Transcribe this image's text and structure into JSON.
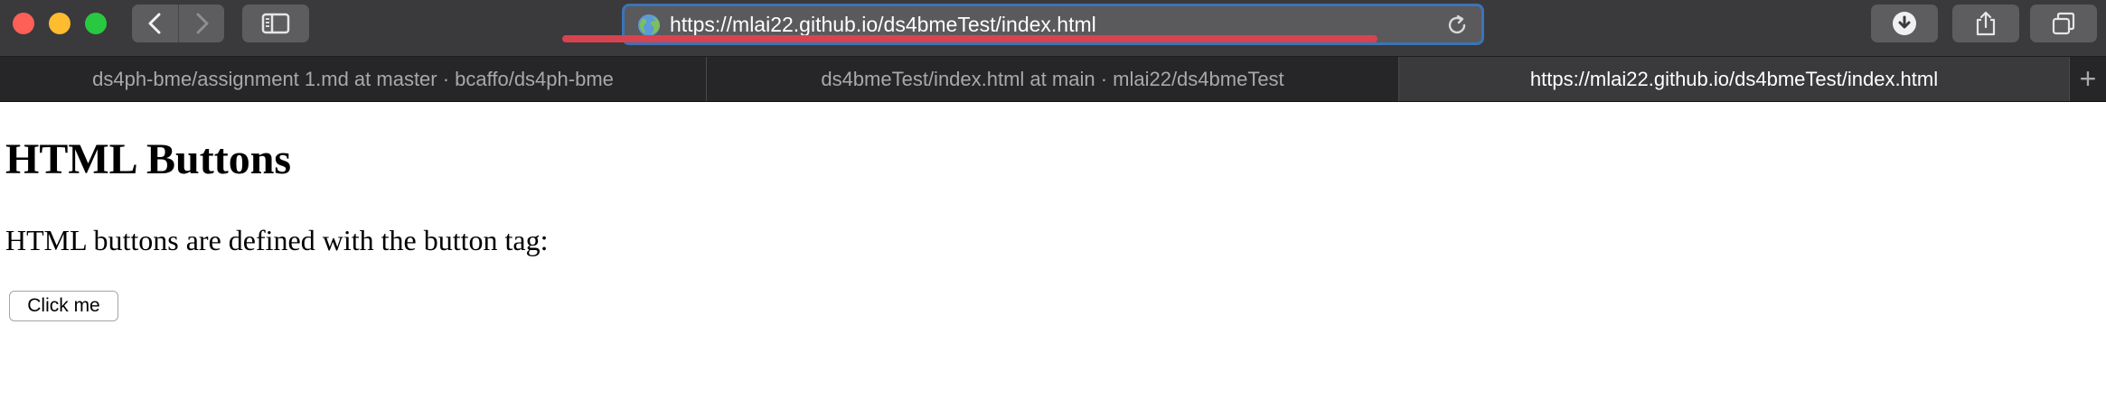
{
  "browser": {
    "address_bar": {
      "url": "https://mlai22.github.io/ds4bmeTest/index.html"
    },
    "tabs": [
      {
        "label": "ds4ph-bme/assignment 1.md at master · bcaffo/ds4ph-bme",
        "active": false
      },
      {
        "label": "ds4bmeTest/index.html at main · mlai22/ds4bmeTest",
        "active": false
      },
      {
        "label": "https://mlai22.github.io/ds4bmeTest/index.html",
        "active": true
      }
    ],
    "new_tab_label": "+",
    "icons": [
      "close-window",
      "minimize-window",
      "zoom-window",
      "chevron-left-icon",
      "chevron-right-icon",
      "sidebar-icon",
      "globe-icon",
      "reload-icon",
      "download-icon",
      "share-icon",
      "tabs-overview-icon"
    ],
    "colors": {
      "address_focus": "#3a74b8",
      "annotation": "#d8434f"
    }
  },
  "page": {
    "heading": "HTML Buttons",
    "paragraph": "HTML buttons are defined with the button tag:",
    "button_label": "Click me"
  }
}
